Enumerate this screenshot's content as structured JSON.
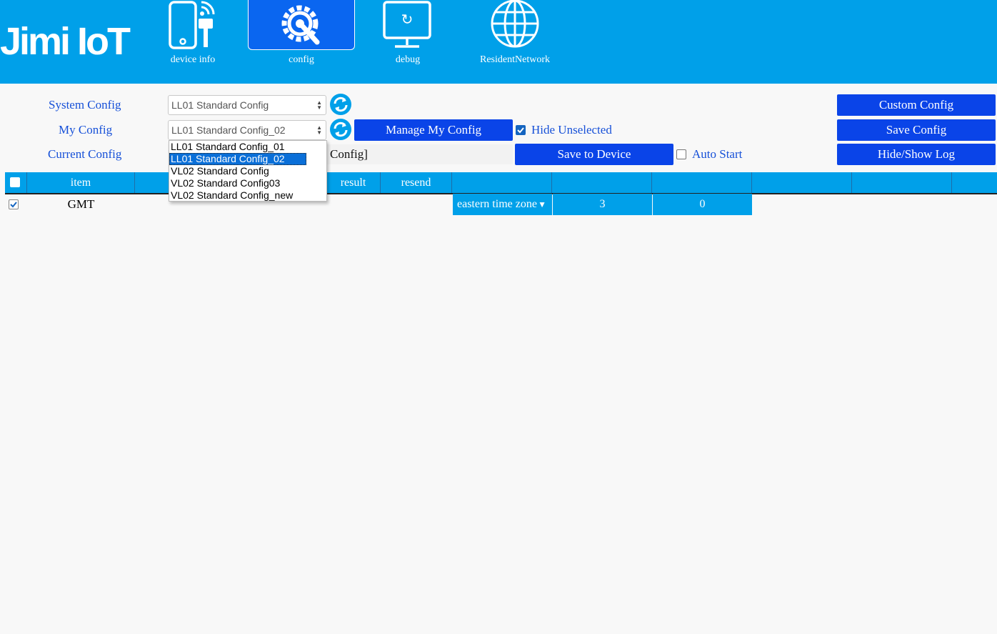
{
  "app": {
    "logo_text": "Jimi IoT",
    "brand_color": "#00a0e9",
    "button_color": "#0a44e8"
  },
  "nav": {
    "tabs": [
      {
        "label": "device info",
        "icon": "phone-signal-icon",
        "active": false
      },
      {
        "label": "config",
        "icon": "gear-wrench-icon",
        "active": true
      },
      {
        "label": "debug",
        "icon": "monitor-sync-icon",
        "active": false
      },
      {
        "label": "ResidentNetwork",
        "icon": "globe-icon",
        "active": false
      }
    ]
  },
  "controls": {
    "system_config_label": "System Config",
    "system_config_value": "LL01 Standard Config",
    "my_config_label": "My Config",
    "my_config_value": "LL01 Standard Config_02",
    "current_config_label": "Current Config",
    "current_config_value": "Config]",
    "manage_button": "Manage My Config",
    "hide_unselected_label": "Hide Unselected",
    "hide_unselected_checked": true,
    "save_to_device_button": "Save to Device",
    "auto_start_label": "Auto Start",
    "auto_start_checked": false,
    "custom_config_button": "Custom Config",
    "save_config_button": "Save Config",
    "hide_show_log_button": "Hide/Show Log"
  },
  "dropdown": {
    "options": [
      "LL01 Standard Config_01",
      "LL01 Standard Config_02",
      "VL02 Standard Config",
      "VL02 Standard Config03",
      "VL02 Standard Config_new"
    ],
    "highlighted_index": 1
  },
  "table": {
    "headers": {
      "item": "item",
      "result": "result",
      "resend": "resend"
    },
    "rows": [
      {
        "checked": true,
        "item": "GMT",
        "value": "eastern time zone",
        "col2": "3",
        "col3": "0"
      }
    ]
  }
}
